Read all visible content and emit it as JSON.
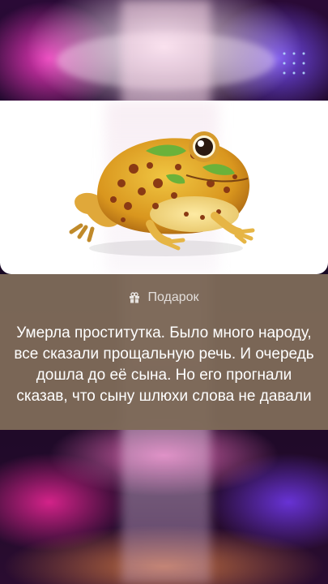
{
  "gift": {
    "label": "Подарок",
    "icon": "gift-icon",
    "message": "Умерла проститутка. Было много народу, все сказали прощальную речь. И очередь дошла до её сына. Но его прогнали сказав, что сыну шлюхи слова не давали"
  },
  "image": {
    "subject": "frog-image"
  },
  "colors": {
    "panel": "#7e6a58",
    "card": "#ffffff",
    "text": "#ffffff"
  }
}
